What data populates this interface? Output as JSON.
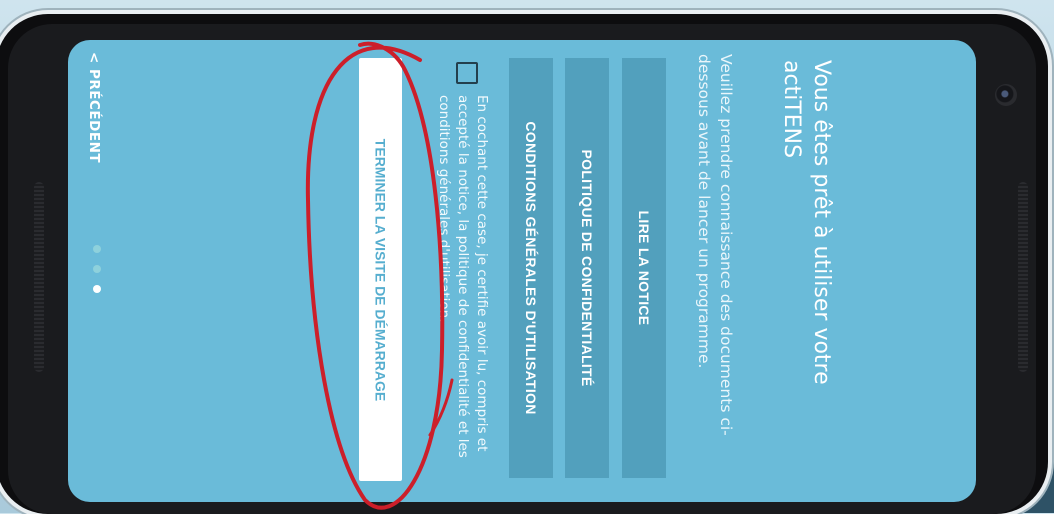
{
  "screen": {
    "title": "Vous êtes prêt à utiliser votre actiTENS",
    "subtitle": "Veuillez prendre connaissance des documents ci-dessous avant de lancer un programme.",
    "buttons": [
      {
        "label": "LIRE LA NOTICE"
      },
      {
        "label": "POLITIQUE DE CONFIDENTIALITÉ"
      },
      {
        "label": "CONDITIONS GÉNÉRALES D'UTILISATION"
      }
    ],
    "consent_checked": false,
    "consent_text": "En cochant cette case, je certifie avoir lu, compris et accepté la notice, la politique de confidentialité et les conditions générales d'utilisation.",
    "finish_label": "TERMINER LA VISITE DE DÉMARRAGE",
    "previous_label": "< PRÉCÉDENT",
    "pagination": {
      "total": 3,
      "current": 3
    }
  },
  "colors": {
    "screen_bg": "#6abbd9",
    "doc_button_bg": "#52a0bd",
    "finish_text": "#56aecf",
    "annotation": "#cc1f2a"
  }
}
